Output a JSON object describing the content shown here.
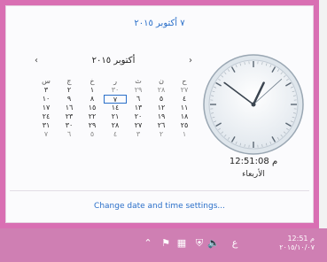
{
  "header": {
    "date_text": "٧ أكتوبر ٢٠١٥"
  },
  "calendar": {
    "prev_label": "‹",
    "next_label": "›",
    "month_label": "أكتوبر ٢٠١٥",
    "weekdays": [
      "ح",
      "ن",
      "ث",
      "ر",
      "خ",
      "ج",
      "س"
    ],
    "weeks": [
      [
        {
          "d": "٢٧",
          "m": true
        },
        {
          "d": "٢٨",
          "m": true
        },
        {
          "d": "٢٩",
          "m": true
        },
        {
          "d": "٣٠",
          "m": true
        },
        {
          "d": "١",
          "m": false
        },
        {
          "d": "٢",
          "m": false
        },
        {
          "d": "٣",
          "m": false
        }
      ],
      [
        {
          "d": "٤",
          "m": false
        },
        {
          "d": "٥",
          "m": false
        },
        {
          "d": "٦",
          "m": false
        },
        {
          "d": "٧",
          "m": false,
          "t": true
        },
        {
          "d": "٨",
          "m": false
        },
        {
          "d": "٩",
          "m": false
        },
        {
          "d": "١٠",
          "m": false
        }
      ],
      [
        {
          "d": "١١",
          "m": false
        },
        {
          "d": "١٢",
          "m": false
        },
        {
          "d": "١٣",
          "m": false
        },
        {
          "d": "١٤",
          "m": false
        },
        {
          "d": "١٥",
          "m": false
        },
        {
          "d": "١٦",
          "m": false
        },
        {
          "d": "١٧",
          "m": false
        }
      ],
      [
        {
          "d": "١٨",
          "m": false
        },
        {
          "d": "١٩",
          "m": false
        },
        {
          "d": "٢٠",
          "m": false
        },
        {
          "d": "٢١",
          "m": false
        },
        {
          "d": "٢٢",
          "m": false
        },
        {
          "d": "٢٣",
          "m": false
        },
        {
          "d": "٢٤",
          "m": false
        }
      ],
      [
        {
          "d": "٢٥",
          "m": false
        },
        {
          "d": "٢٦",
          "m": false
        },
        {
          "d": "٢٧",
          "m": false
        },
        {
          "d": "٢٨",
          "m": false
        },
        {
          "d": "٢٩",
          "m": false
        },
        {
          "d": "٣٠",
          "m": false
        },
        {
          "d": "٣١",
          "m": false
        }
      ],
      [
        {
          "d": "١",
          "m": true
        },
        {
          "d": "٢",
          "m": true
        },
        {
          "d": "٣",
          "m": true
        },
        {
          "d": "٤",
          "m": true
        },
        {
          "d": "٥",
          "m": true
        },
        {
          "d": "٦",
          "m": true
        },
        {
          "d": "٧",
          "m": true
        }
      ]
    ]
  },
  "clock": {
    "time_text": "م 12:51:08",
    "day_text": "الأربعاء",
    "hours": 12,
    "minutes": 51,
    "seconds": 8
  },
  "settings_link": "Change date and time settings...",
  "taskbar": {
    "tray_time": "12:51 م",
    "tray_date": "٢٠١٥/١٠/٠٧",
    "lang": "ع"
  },
  "colors": {
    "accent": "#2a6fc9",
    "frame": "#d96fb3",
    "taskbar": "#cf7fb3"
  }
}
